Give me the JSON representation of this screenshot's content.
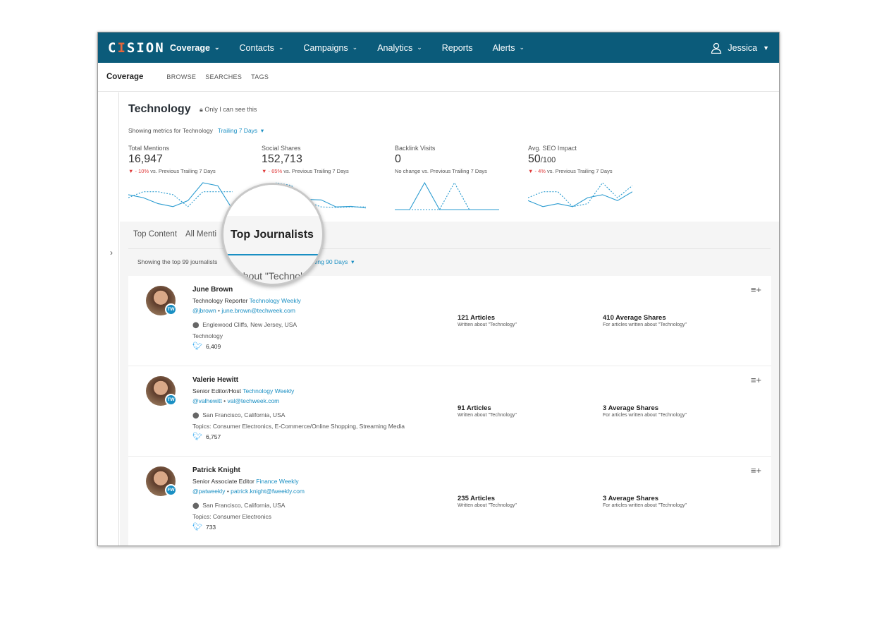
{
  "brand": {
    "logo": "CISION"
  },
  "nav": {
    "items": [
      {
        "label": "Coverage",
        "dropdown": true,
        "active": true
      },
      {
        "label": "Contacts",
        "dropdown": true
      },
      {
        "label": "Campaigns",
        "dropdown": true
      },
      {
        "label": "Analytics",
        "dropdown": true
      },
      {
        "label": "Reports",
        "dropdown": false
      },
      {
        "label": "Alerts",
        "dropdown": true
      }
    ],
    "user": "Jessica"
  },
  "subnav": {
    "title": "Coverage",
    "links": [
      "BROWSE",
      "SEARCHES",
      "TAGS"
    ]
  },
  "page": {
    "title": "Technology",
    "privacy": "Only I can see this",
    "showing": "Showing metrics for Technology",
    "period": "Trailing 7 Days"
  },
  "metrics": [
    {
      "label": "Total Mentions",
      "value": "16,947",
      "suffix": "",
      "change": "- 10%",
      "note": "vs. Previous Trailing 7 Days",
      "current": [
        5,
        4,
        2,
        1,
        3,
        9,
        8,
        0
      ],
      "previous": [
        4,
        6,
        6,
        5,
        1,
        6,
        6,
        6
      ]
    },
    {
      "label": "Social Shares",
      "value": "152,713",
      "suffix": "",
      "change": "- 65%",
      "note": "vs. Previous Trailing 7 Days",
      "current": [
        4,
        4,
        4,
        3.8,
        3.6,
        1,
        1.2,
        0.6
      ],
      "previous": [
        3,
        10,
        9,
        3,
        1,
        0.8,
        1,
        1
      ]
    },
    {
      "label": "Backlink Visits",
      "value": "0",
      "suffix": "",
      "change": "No change",
      "note": "vs. Previous Trailing 7 Days",
      "current": [
        0,
        0,
        10,
        0,
        0,
        0,
        0,
        0
      ],
      "previous": [
        0,
        0,
        0,
        0,
        10,
        0,
        0,
        0
      ]
    },
    {
      "label": "Avg. SEO Impact",
      "value": "50",
      "suffix": "/100",
      "change": "- 4%",
      "note": "vs. Previous Trailing 7 Days",
      "current": [
        3,
        1,
        2,
        1,
        4,
        5,
        3,
        6
      ],
      "previous": [
        4,
        6,
        6,
        1,
        2,
        9,
        4,
        8
      ]
    }
  ],
  "sparkline_colors": {
    "line": "#2a9bd0"
  },
  "tabs": [
    "Top Content",
    "All Menti",
    "Top Journalists"
  ],
  "journalists_summary": {
    "showing": "Showing the top 99 journalists",
    "about": "about \"Technolo",
    "period": "ailing 90 Days"
  },
  "journalists": [
    {
      "name": "June Brown",
      "role": "Technology Reporter",
      "outlet": "Technology Weekly",
      "badge": "TW",
      "handle": "@jbrown",
      "email": "june.brown@techweek.com",
      "location": "Englewood Cliffs, New Jersey, USA",
      "topics": "Technology",
      "followers": "6,409",
      "articles": "121 Articles",
      "articles_note": "Written about \"Technology\"",
      "shares": "410 Average Shares",
      "shares_note": "For articles written about \"Technology\""
    },
    {
      "name": "Valerie Hewitt",
      "role": "Senior Editor/Host",
      "outlet": "Technology Weekly",
      "badge": "TW",
      "handle": "@valhewitt",
      "email": "val@techweek.com",
      "location": "San Francisco, California, USA",
      "topics": "Topics: Consumer Electronics, E-Commerce/Online Shopping, Streaming Media",
      "followers": "6,757",
      "articles": "91 Articles",
      "articles_note": "Written about \"Technology\"",
      "shares": "3 Average Shares",
      "shares_note": "For articles written about \"Technology\""
    },
    {
      "name": "Patrick Knight",
      "role": "Senior Associate Editor",
      "outlet": "Finance Weekly",
      "badge": "FW",
      "handle": "@patweekly",
      "email": "patrick.knight@fweekly.com",
      "location": "San Francisco, California, USA",
      "topics": "Topics: Consumer Electronics",
      "followers": "733",
      "articles": "235 Articles",
      "articles_note": "Written about \"Technology\"",
      "shares": "3 Average Shares",
      "shares_note": "For articles written about \"Technology\""
    }
  ]
}
